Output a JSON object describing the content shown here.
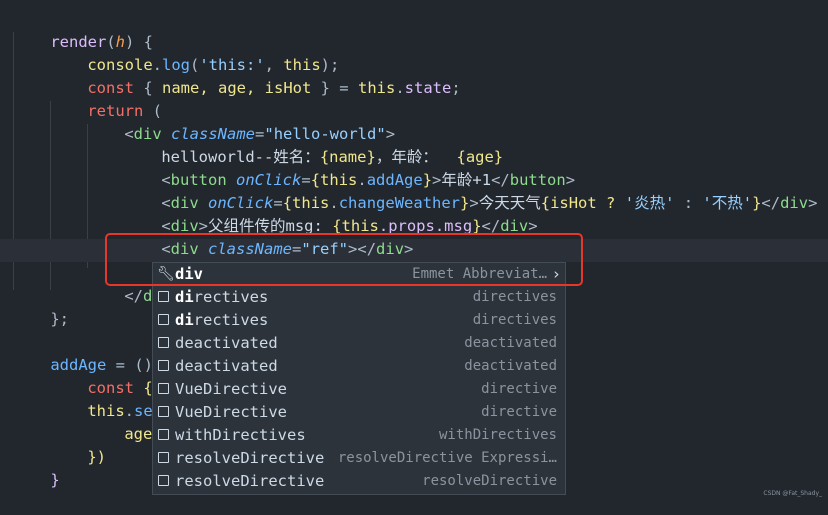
{
  "code": {
    "l1": {
      "kw": "render",
      "open": "(",
      "param": "h",
      "close": ") {"
    },
    "l2": {
      "obj": "console",
      "dot": ".",
      "fn": "log",
      "open": "(",
      "str": "'this:'",
      "comma": ", ",
      "this": "this",
      "close": ");"
    },
    "l3": {
      "kw": "const",
      "open": " { ",
      "vars": "name, age, isHot",
      "close": " } = ",
      "this": "this",
      "dot": ".",
      "prop": "state",
      "end": ";"
    },
    "l4": {
      "kw": "return",
      "rest": " ("
    },
    "l5": {
      "lt": "<",
      "tag": "div",
      "attr": "className",
      "eq": "=",
      "val": "\"hello-world\"",
      "gt": ">"
    },
    "l6": {
      "text": "helloworld--姓名：",
      "e1": "{name}",
      "mid": "，年龄：  ",
      "e2": "{age}"
    },
    "l7": {
      "lt": "<",
      "tag": "button",
      "attr": "onClick",
      "eq": "=",
      "ob": "{",
      "this": "this",
      "dot": ".",
      "fn": "addAge",
      "cb": "}",
      "gt": ">",
      "text": "年龄+1",
      "close": "</",
      "ctag": "button",
      "cgt": ">"
    },
    "l8": {
      "lt": "<",
      "tag": "div",
      "attr": "onClick",
      "eq": "=",
      "ob": "{",
      "this": "this",
      "dot": ".",
      "fn": "changeWeather",
      "cb": "}",
      "gt": ">",
      "text": "今天天气",
      "expr1": "{isHot ? ",
      "s1": "'炎热'",
      "c": " : ",
      "s2": "'不热'",
      "expr2": "}",
      "close": "</",
      "ctag": "div",
      "cgt": ">"
    },
    "l9": {
      "lt": "<",
      "tag": "div",
      "gt": ">",
      "text": "父组件传的msg: ",
      "ob": "{",
      "this": "this",
      "rest": ".props.msg",
      "cb": "}",
      "close": "</",
      "ctag": "div",
      "cgt": ">"
    },
    "l10": {
      "lt": "<",
      "tag": "div",
      "attr": "className",
      "eq": "=",
      "val": "\"ref\"",
      "gt": ">",
      "close": "</",
      "ctag": "div",
      "cgt": ">"
    },
    "l11": {
      "typed": "div"
    },
    "l12": {
      "close": "</",
      "ctag": "div",
      "cgt": ">",
      "paren": ")"
    },
    "l13": {
      "text": "};"
    },
    "l15": {
      "name": "addAge",
      "rest": " = () => "
    },
    "l16": {
      "kw": "const",
      "rest": " { age"
    },
    "l17": {
      "this": "this",
      "dot": ".",
      "fn": "setSta"
    },
    "l18": {
      "text": "age: ag"
    },
    "l19": {
      "text": "})"
    },
    "l20": {
      "text": "}"
    }
  },
  "suggest": {
    "items": [
      {
        "match": "div",
        "rest": "",
        "detail": "Emmet Abbreviat…",
        "kind": "wrench-icon"
      },
      {
        "match": "di",
        "rest": "rectives",
        "detail": "directives"
      },
      {
        "match": "di",
        "rest": "rectives",
        "detail": "directives"
      },
      {
        "pre": "",
        "label": "deactivated",
        "detail": "deactivated"
      },
      {
        "pre": "",
        "label": "deactivated",
        "detail": "deactivated"
      },
      {
        "label": "VueDirective",
        "detail": "directive"
      },
      {
        "label": "VueDirective",
        "detail": "directive"
      },
      {
        "label": "withDirectives",
        "detail": "withDirectives"
      },
      {
        "label": "resolveDirective",
        "detail": "resolveDirective Expressi…"
      },
      {
        "label": "resolveDirective",
        "detail": "resolveDirective"
      }
    ]
  },
  "watermark": "CSDN @Fat_Shady_",
  "colors": {
    "background": "#22272e",
    "highlight_box": "#e8362b"
  }
}
